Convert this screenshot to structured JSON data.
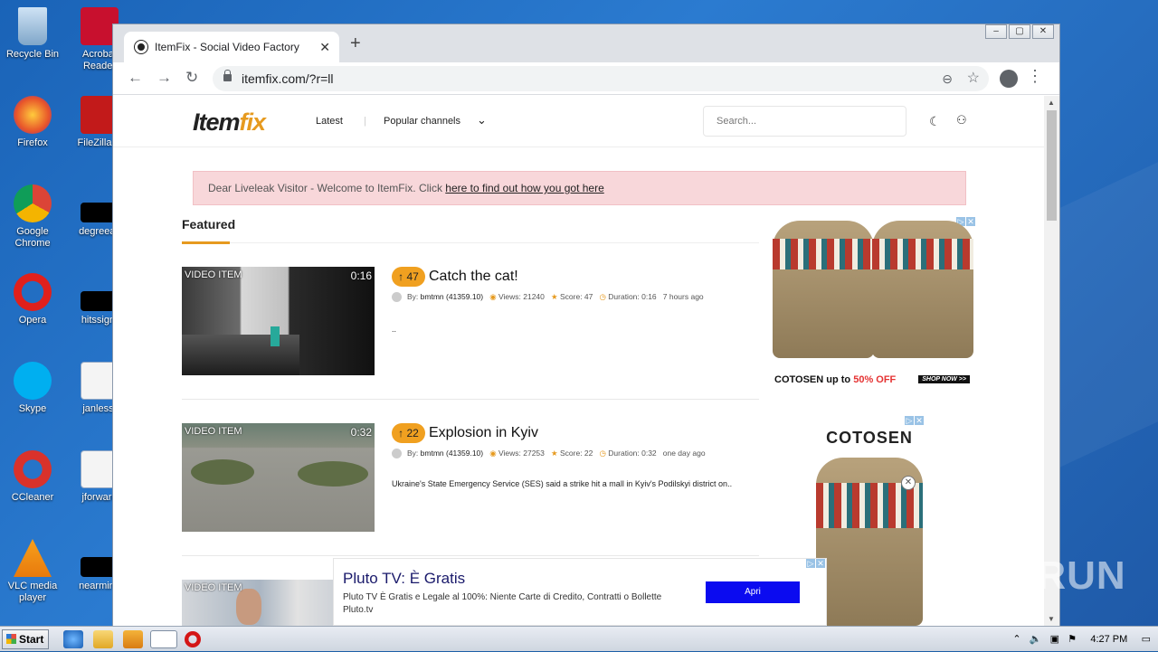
{
  "desktop": {
    "icons": [
      {
        "label": "Recycle Bin"
      },
      {
        "label": "Acrobat Reader"
      },
      {
        "label": "Firefox"
      },
      {
        "label": "FileZilla C"
      },
      {
        "label": "Google Chrome"
      },
      {
        "label": "degreeac"
      },
      {
        "label": "Opera"
      },
      {
        "label": "hitssign."
      },
      {
        "label": "Skype"
      },
      {
        "label": "janless."
      },
      {
        "label": "CCleaner"
      },
      {
        "label": "jforward"
      },
      {
        "label": "VLC media player"
      },
      {
        "label": "nearminu"
      }
    ]
  },
  "browser": {
    "tab_title": "ItemFix - Social Video Factory",
    "url": "itemfix.com/?r=ll"
  },
  "site": {
    "logo_main": "Item",
    "logo_accent": "fix",
    "nav": {
      "latest": "Latest",
      "popular": "Popular channels"
    },
    "search_placeholder": "Search...",
    "alert_text": "Dear Liveleak Visitor - Welcome to ItemFix. Click ",
    "alert_link": "here to find out how you got here",
    "featured": "Featured",
    "items": [
      {
        "label": "VIDEO ITEM",
        "duration": "0:16",
        "votes": "47",
        "title": "Catch the cat!",
        "by": "By:",
        "author": "bmtmn (41359.10)",
        "views": "Views: 21240",
        "score": "Score: 47",
        "dur_text": "Duration: 0:16",
        "age": "7 hours ago",
        "desc": ".."
      },
      {
        "label": "VIDEO ITEM",
        "duration": "0:32",
        "votes": "22",
        "title": "Explosion in Kyiv",
        "by": "By:",
        "author": "bmtmn (41359.10)",
        "views": "Views: 27253",
        "score": "Score: 22",
        "dur_text": "Duration: 0:32",
        "age": "one day ago",
        "desc": "Ukraine's State Emergency Service (SES) said a strike hit a mall in Kyiv's Podilskyi district on.."
      },
      {
        "label": "VIDEO ITEM"
      }
    ],
    "ad1": {
      "brand": "COTOSEN",
      "mid": " up to ",
      "offer": "50% OFF",
      "shop": "SHOP NOW >>"
    },
    "ad2": {
      "brand": "COTOSEN"
    },
    "bottom_ad": {
      "title": "Pluto TV: È Gratis",
      "desc": "Pluto TV È Gratis e Legale al 100%: Niente Carte di Credito, Contratti o Bollette Pluto.tv",
      "button": "Apri"
    }
  },
  "taskbar": {
    "start": "Start",
    "time": "4:27 PM"
  },
  "watermark": "ANY RUN"
}
